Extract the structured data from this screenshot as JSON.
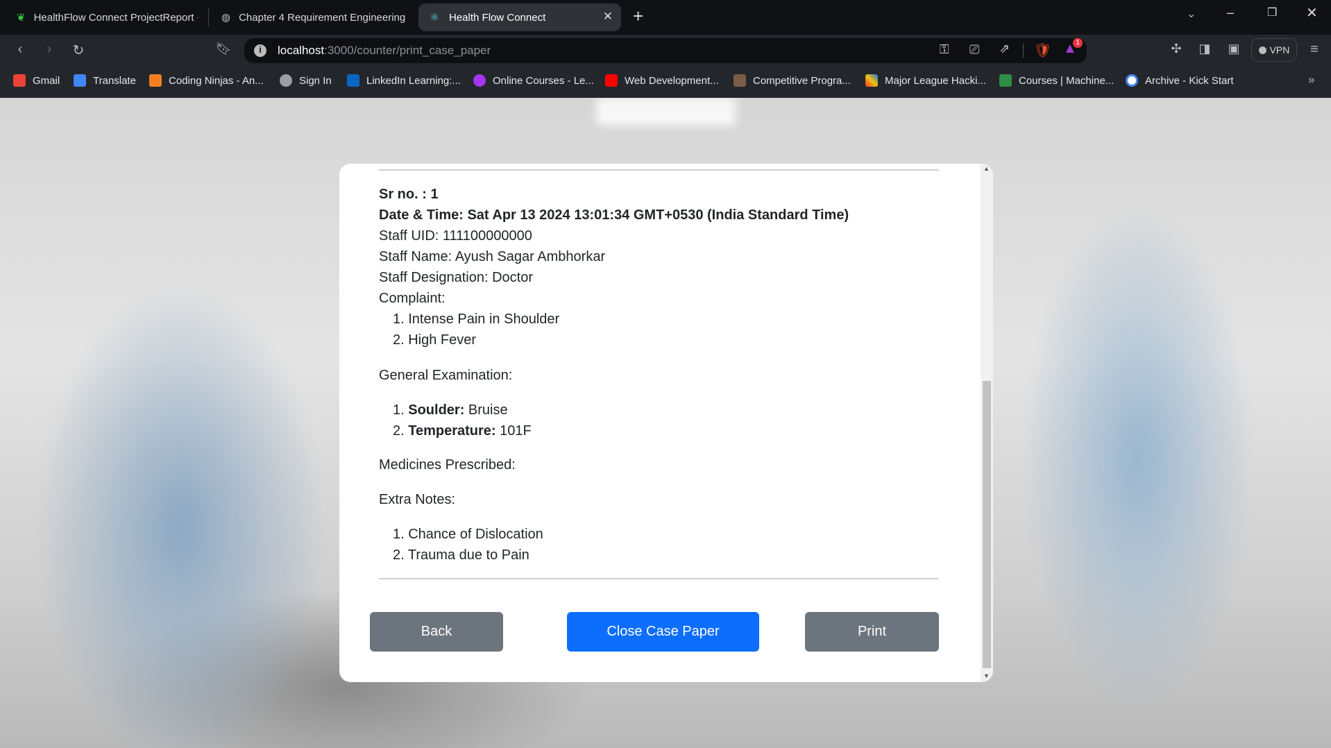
{
  "browser": {
    "tabs": [
      {
        "title": "HealthFlow Connect ProjectReport - ",
        "icon": "leaf-icon"
      },
      {
        "title": "Chapter 4 Requirement Engineering.",
        "icon": "globe-icon"
      },
      {
        "title": "Health Flow Connect",
        "icon": "react-icon",
        "active": true
      }
    ],
    "url_host": "localhost",
    "url_path": ":3000/counter/print_case_paper",
    "vpn_label": "VPN",
    "notification_count": "1",
    "bookmarks": [
      {
        "label": "Gmail",
        "color": "#ea4335"
      },
      {
        "label": "Translate",
        "color": "#4285f4"
      },
      {
        "label": "Coding Ninjas - An...",
        "color": "#f47f20"
      },
      {
        "label": "Sign In",
        "color": "#9aa0a6"
      },
      {
        "label": "LinkedIn Learning:...",
        "color": "#0a66c2"
      },
      {
        "label": "Online Courses - Le...",
        "color": "#a435f0"
      },
      {
        "label": "Web Development...",
        "color": "#ff0000"
      },
      {
        "label": "Competitive Progra...",
        "color": "#7a5c48"
      },
      {
        "label": "Major League Hacki...",
        "color": "#e73427"
      },
      {
        "label": "Courses | Machine...",
        "color": "#2f8d46"
      },
      {
        "label": "Archive - Kick Start",
        "color": "#ffffff"
      }
    ],
    "more_bookmarks": "»"
  },
  "case_paper": {
    "sr_no": "Sr no. : 1",
    "date_time": "Date & Time: Sat Apr 13 2024 13:01:34 GMT+0530 (India Standard Time)",
    "staff_uid": "Staff UID: 111100000000",
    "staff_name": "Staff Name: Ayush Sagar Ambhorkar",
    "staff_designation": "Staff Designation: Doctor",
    "complaint_label": "Complaint:",
    "complaints": [
      "1. Intense Pain in Shoulder",
      "2. High Fever"
    ],
    "general_exam_label": "General Examination:",
    "general_exam": [
      {
        "num": "1. ",
        "key": "Soulder:",
        "value": " Bruise"
      },
      {
        "num": "2. ",
        "key": "Temperature:",
        "value": " 101F"
      }
    ],
    "medicines_label": "Medicines Prescribed:",
    "extra_notes_label": "Extra Notes:",
    "extra_notes": [
      "1. Chance of Dislocation",
      "2. Trauma due to Pain"
    ]
  },
  "buttons": {
    "back": "Back",
    "close": "Close Case Paper",
    "print": "Print"
  },
  "colors": {
    "primary": "#0d6efd",
    "secondary": "#6c757d"
  }
}
